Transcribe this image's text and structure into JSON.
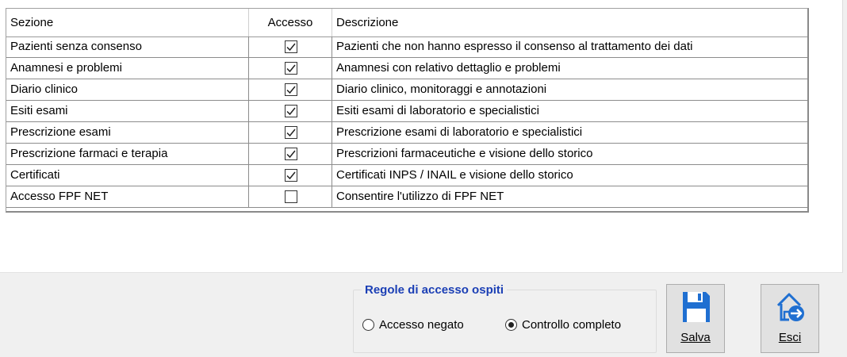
{
  "columns": {
    "sezione": "Sezione",
    "accesso": "Accesso",
    "descrizione": "Descrizione"
  },
  "rows": [
    {
      "sezione": "Pazienti senza consenso",
      "accesso": true,
      "descrizione": "Pazienti che non hanno espresso il consenso al trattamento dei dati"
    },
    {
      "sezione": "Anamnesi e problemi",
      "accesso": true,
      "descrizione": "Anamnesi con relativo dettaglio e problemi"
    },
    {
      "sezione": "Diario clinico",
      "accesso": true,
      "descrizione": "Diario clinico, monitoraggi e annotazioni"
    },
    {
      "sezione": "Esiti esami",
      "accesso": true,
      "descrizione": "Esiti esami di laboratorio e specialistici"
    },
    {
      "sezione": "Prescrizione esami",
      "accesso": true,
      "descrizione": "Prescrizione esami di laboratorio e specialistici"
    },
    {
      "sezione": "Prescrizione farmaci e terapia",
      "accesso": true,
      "descrizione": "Prescrizioni farmaceutiche e visione dello storico"
    },
    {
      "sezione": "Certificati",
      "accesso": true,
      "descrizione": "Certificati INPS / INAIL e visione dello storico"
    },
    {
      "sezione": "Accesso FPF NET",
      "accesso": false,
      "descrizione": "Consentire l'utilizzo di FPF NET"
    }
  ],
  "guest_rules": {
    "title": "Regole di accesso ospiti",
    "options": [
      {
        "label": "Accesso negato",
        "selected": false
      },
      {
        "label": "Controllo completo",
        "selected": true
      }
    ]
  },
  "buttons": {
    "save": {
      "label": "Salva",
      "icon": "floppy-disk-icon"
    },
    "exit": {
      "label": "Esci",
      "icon": "home-exit-icon"
    }
  },
  "colors": {
    "group_title": "#1b3fb5",
    "save_icon": "#1f6fd1",
    "exit_icon": "#1f6fd1"
  }
}
